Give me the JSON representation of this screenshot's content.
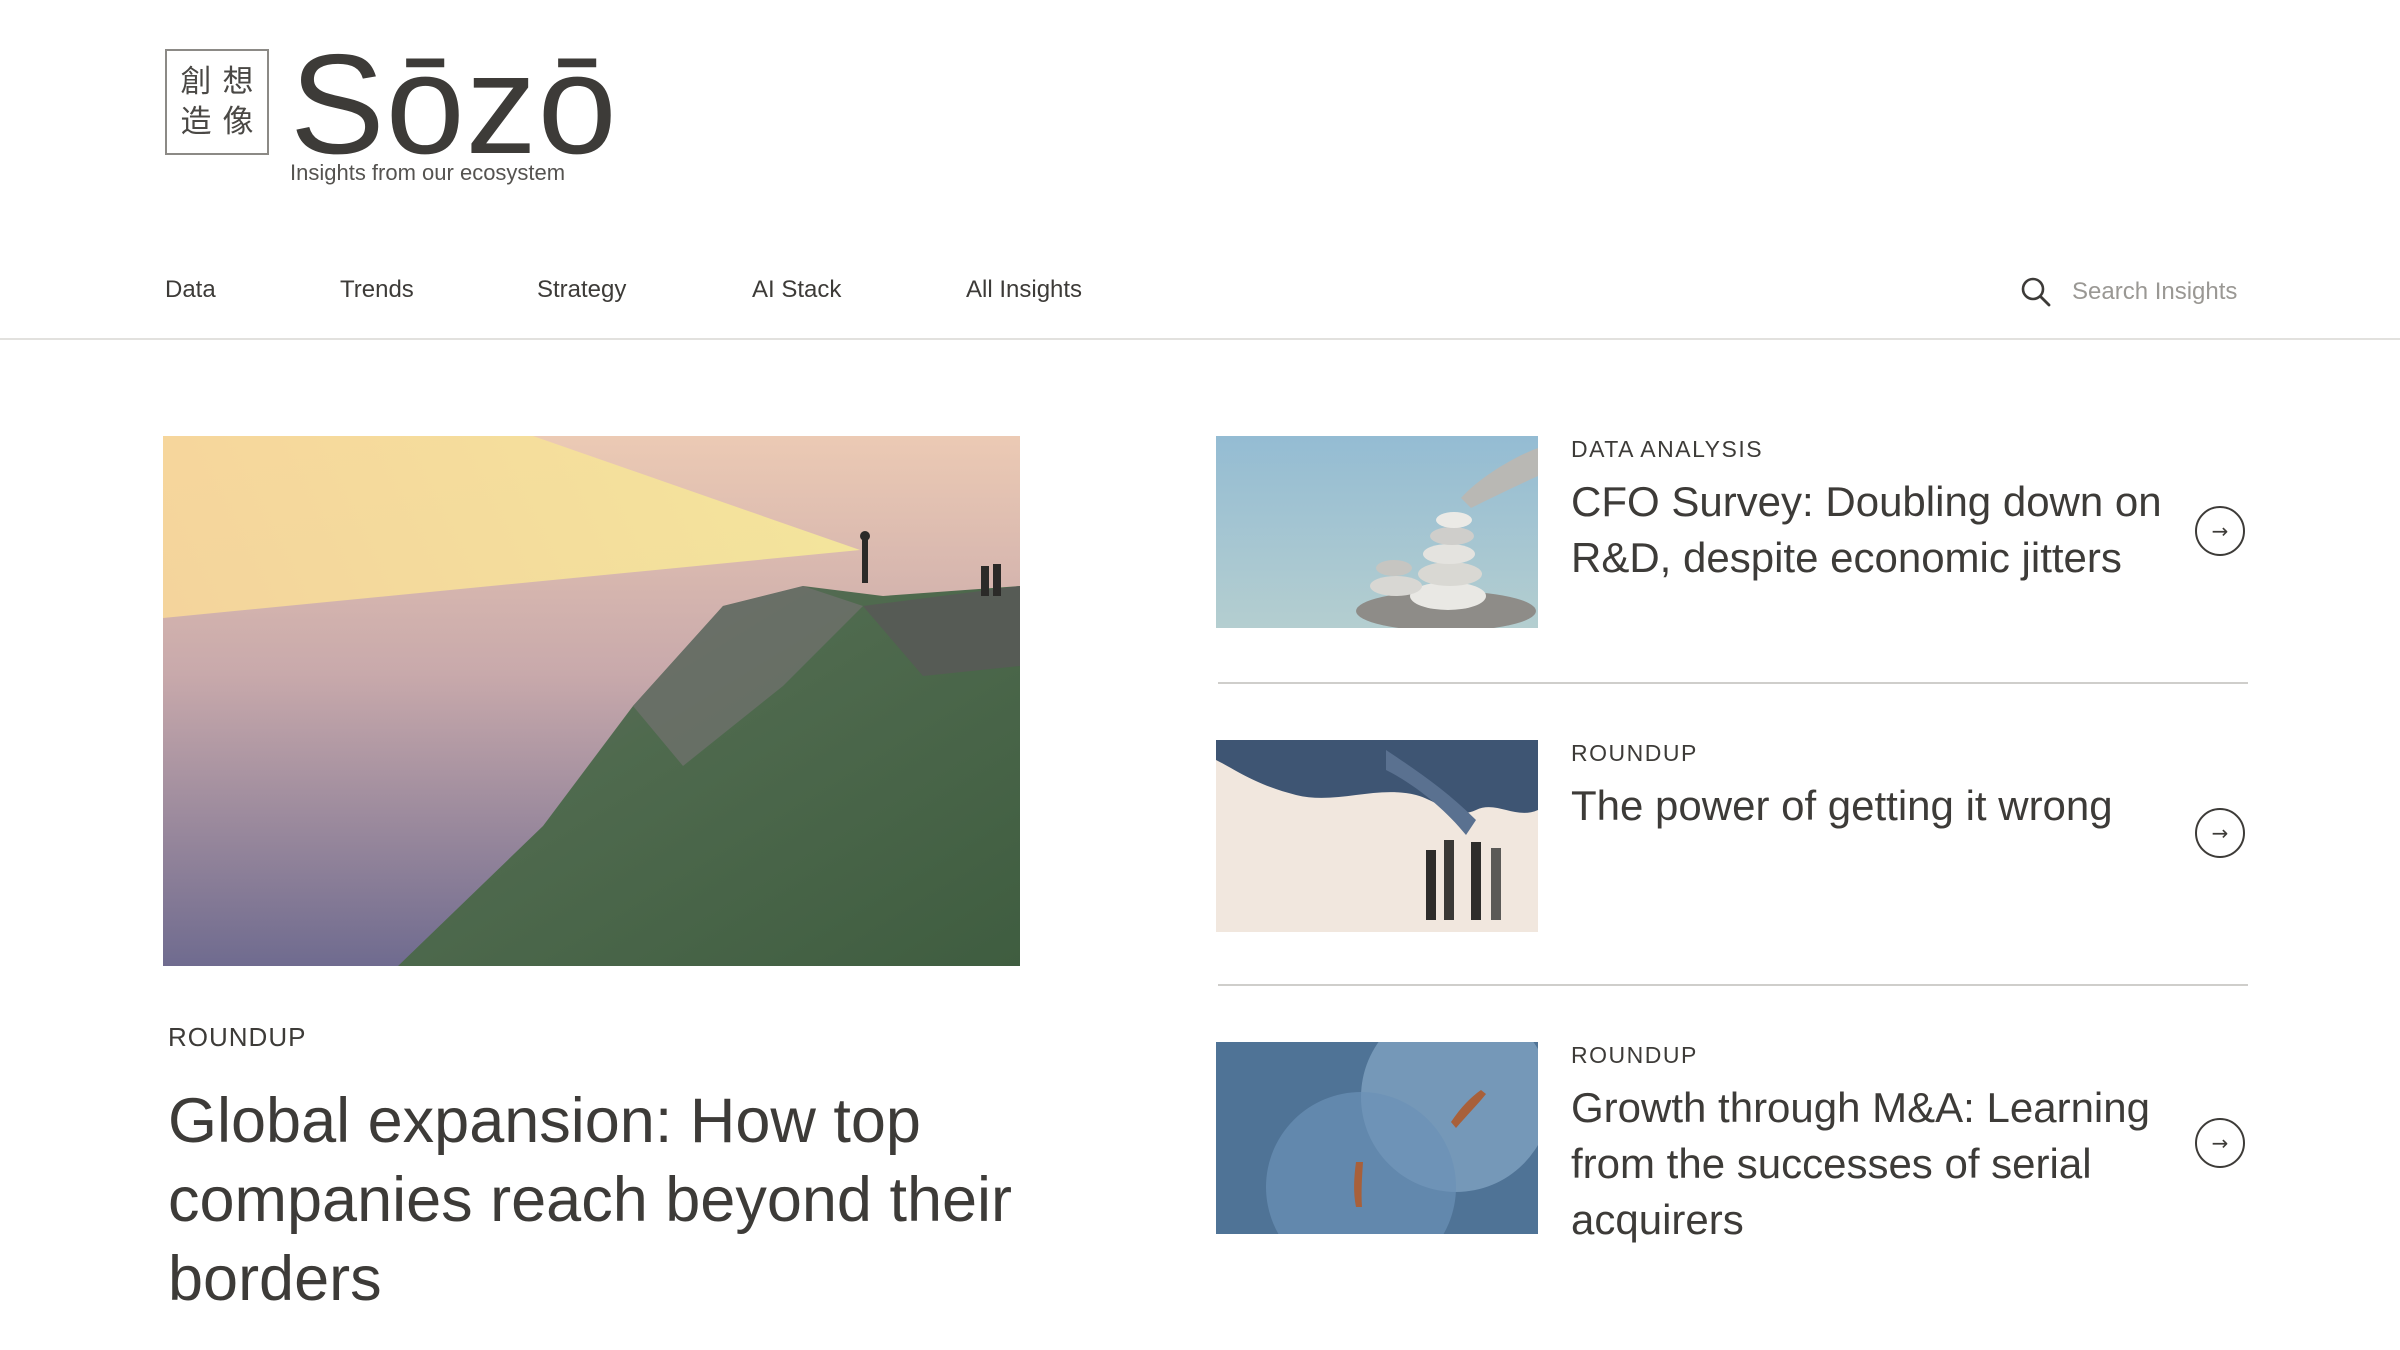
{
  "brand": {
    "logo_chars": [
      "創",
      "想",
      "造",
      "像"
    ],
    "name": "Sōzō",
    "tagline": "Insights from our ecosystem"
  },
  "nav": {
    "items": [
      {
        "label": "Data"
      },
      {
        "label": "Trends"
      },
      {
        "label": "Strategy"
      },
      {
        "label": "AI Stack"
      },
      {
        "label": "All Insights"
      }
    ],
    "search_placeholder": "Search Insights",
    "search_icon": "search-icon"
  },
  "hero": {
    "category": "ROUNDUP",
    "title": "Global expansion: How top companies reach beyond their borders"
  },
  "cards": [
    {
      "category": "DATA ANALYSIS",
      "title": "CFO Survey: Doubling down on R&D, despite economic jitters",
      "arrow": "→"
    },
    {
      "category": "ROUNDUP",
      "title": "The power of getting it wrong",
      "arrow": "→"
    },
    {
      "category": "ROUNDUP",
      "title": "Growth through M&A: Learning from the successes of serial acquirers",
      "arrow": "→"
    }
  ],
  "colors": {
    "text": "#3d3b38",
    "divider": "#e2e1de"
  }
}
